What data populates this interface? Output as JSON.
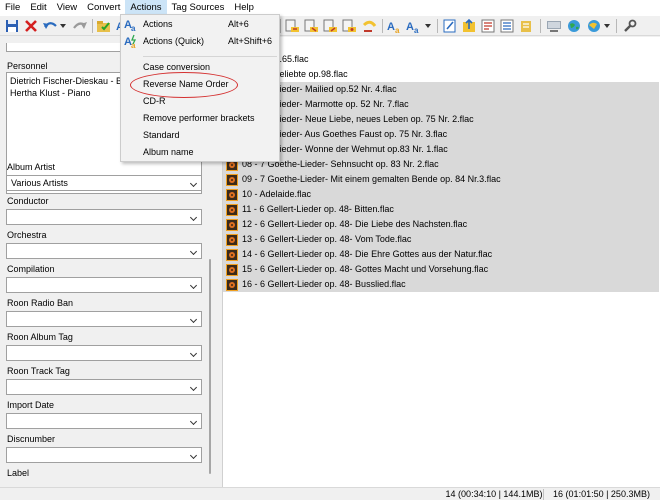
{
  "menubar": {
    "items": [
      "File",
      "Edit",
      "View",
      "Convert",
      "Actions",
      "Tag Sources",
      "Help"
    ],
    "open_item": "Actions"
  },
  "actions_menu": {
    "items": [
      {
        "label": "Actions",
        "shortcut": "Alt+6",
        "icon": "actions-icon"
      },
      {
        "label": "Actions (Quick)",
        "shortcut": "Alt+Shift+6",
        "icon": "actions-quick-icon"
      },
      {
        "label": "Case conversion",
        "shortcut": ""
      },
      {
        "label": "Reverse Name Order",
        "shortcut": ""
      },
      {
        "label": "CD-R",
        "shortcut": ""
      },
      {
        "label": "Remove performer brackets",
        "shortcut": ""
      },
      {
        "label": "Standard",
        "shortcut": ""
      },
      {
        "label": "Album name",
        "shortcut": ""
      }
    ],
    "highlighted": "Reverse Name Order",
    "highlight_color": "#d43030"
  },
  "left_panel": {
    "personnel_label": "Personnel",
    "personnel": [
      "Dietrich Fischer-Dieskau - Ba",
      "Hertha Klust - Piano"
    ],
    "fields": [
      {
        "label": "Album Artist",
        "value": "Various Artists"
      },
      {
        "label": "Conductor",
        "value": ""
      },
      {
        "label": "Orchestra",
        "value": ""
      },
      {
        "label": "Compilation",
        "value": ""
      },
      {
        "label": "Roon Radio Ban",
        "value": ""
      },
      {
        "label": "Roon Album Tag",
        "value": ""
      },
      {
        "label": "Roon Track Tag",
        "value": ""
      },
      {
        "label": "Import Date",
        "value": ""
      },
      {
        "label": "Discnumber",
        "value": ""
      },
      {
        "label": "Label",
        "value": ""
      }
    ]
  },
  "files": [
    {
      "name": "erfido! op.65.flac",
      "selected": false
    },
    {
      "name": "e ferne Geliebte op.98.flac",
      "selected": false
    },
    {
      "name": "Goethe-Lieder- Mailied op.52 Nr. 4.flac",
      "selected": true
    },
    {
      "name": "Goethe-Lieder- Marmotte op. 52 Nr. 7.flac",
      "selected": true
    },
    {
      "name": "Goethe-Lieder- Neue Liebe, neues Leben op. 75 Nr. 2.flac",
      "selected": true
    },
    {
      "name": "Goethe-Lieder- Aus Goethes Faust op. 75 Nr. 3.flac",
      "selected": true
    },
    {
      "name": "Goethe-Lieder- Wonne der Wehmut op.83 Nr. 1.flac",
      "selected": true
    },
    {
      "name": "08 - 7 Goethe-Lieder- Sehnsucht op. 83 Nr. 2.flac",
      "selected": true
    },
    {
      "name": "09 - 7 Goethe-Lieder- Mit einem gemalten Bende op. 84 Nr.3.flac",
      "selected": true
    },
    {
      "name": "10 - Adelaide.flac",
      "selected": true
    },
    {
      "name": "11 - 6 Gellert-Lieder op. 48- Bitten.flac",
      "selected": true
    },
    {
      "name": "12 - 6 Gellert-Lieder op. 48- Die Liebe des Nachsten.flac",
      "selected": true
    },
    {
      "name": "13 - 6 Gellert-Lieder op. 48- Vom Tode.flac",
      "selected": true
    },
    {
      "name": "14 - 6 Gellert-Lieder op. 48- Die Ehre Gottes aus der Natur.flac",
      "selected": true
    },
    {
      "name": "15 - 6 Gellert-Lieder op. 48- Gottes Macht und Vorsehung.flac",
      "selected": true
    },
    {
      "name": "16 - 6 Gellert-Lieder op. 48- Busslied.flac",
      "selected": true
    }
  ],
  "statusbar": {
    "selected": "14 (00:34:10 | 144.1MB)",
    "total": "16 (01:01:50 | 250.3MB)"
  }
}
